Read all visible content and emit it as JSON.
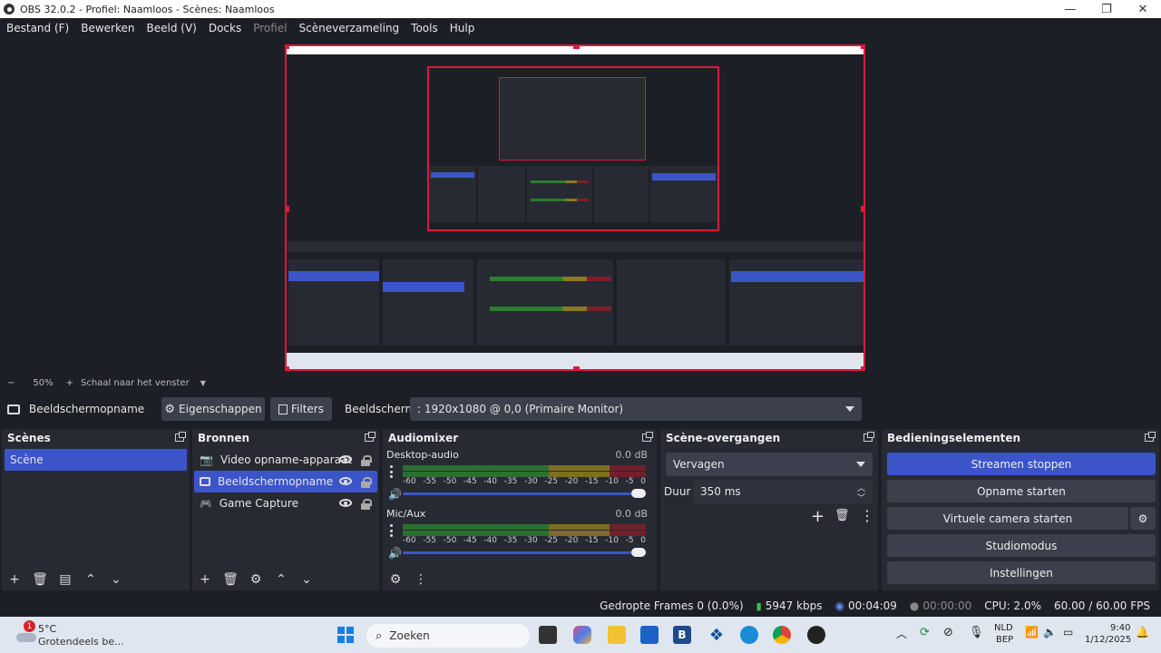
{
  "window": {
    "title": "OBS 32.0.2 - Profiel: Naamloos - Scènes: Naamloos",
    "minimize": "—",
    "maximize": "❐",
    "close": "✕"
  },
  "menu": [
    "Bestand (F)",
    "Bewerken",
    "Beeld (V)",
    "Docks",
    "Profiel",
    "Scèneverzameling",
    "Tools",
    "Hulp"
  ],
  "zoom": {
    "minus": "−",
    "percent": "50%",
    "plus": "+",
    "scale_label": "Schaal naar het venster"
  },
  "source_bar": {
    "source_name": "Beeldschermopname",
    "properties": "Eigenschappen",
    "filters": "Filters",
    "screen_label": "Beeldscherm",
    "screen_value": ": 1920x1080 @ 0,0 (Primaire Monitor)"
  },
  "scenes": {
    "title": "Scènes",
    "items": [
      "Scène"
    ]
  },
  "sources": {
    "title": "Bronnen",
    "items": [
      "Video opname-apparaat",
      "Beeldschermopname",
      "Game Capture"
    ]
  },
  "mixer": {
    "title": "Audiomixer",
    "channels": [
      {
        "name": "Desktop-audio",
        "db": "0.0 dB"
      },
      {
        "name": "Mic/Aux",
        "db": "0.0 dB"
      }
    ],
    "scale": [
      "-60",
      "-55",
      "-50",
      "-45",
      "-40",
      "-35",
      "-30",
      "-25",
      "-20",
      "-15",
      "-10",
      "-5",
      "0"
    ]
  },
  "transitions": {
    "title": "Scène-overgangen",
    "selected": "Vervagen",
    "duration_label": "Duur",
    "duration_value": "350 ms"
  },
  "controls": {
    "title": "Bedieningselementen",
    "stop_streaming": "Streamen stoppen",
    "start_recording": "Opname starten",
    "virtual_camera": "Virtuele camera starten",
    "studio_mode": "Studiomodus",
    "settings": "Instellingen"
  },
  "status": {
    "dropped_frames": "Gedropte Frames 0 (0.0%)",
    "bitrate": "5947 kbps",
    "stream_time": "00:04:09",
    "record_time": "00:00:00",
    "cpu": "CPU: 2.0%",
    "fps": "60.00 / 60.00 FPS"
  },
  "taskbar": {
    "weather_temp": "5°C",
    "weather_desc": "Grotendeels be...",
    "weather_badge": "1",
    "search_placeholder": "Zoeken",
    "lang_top": "NLD",
    "lang_bottom": "BEP",
    "time": "9:40",
    "date": "1/12/2025"
  },
  "colors": {
    "accent": "#3b55c9",
    "selection_border": "#e0163b",
    "background": "#1d1f26",
    "panel": "#272a33",
    "button": "#3c404d"
  }
}
